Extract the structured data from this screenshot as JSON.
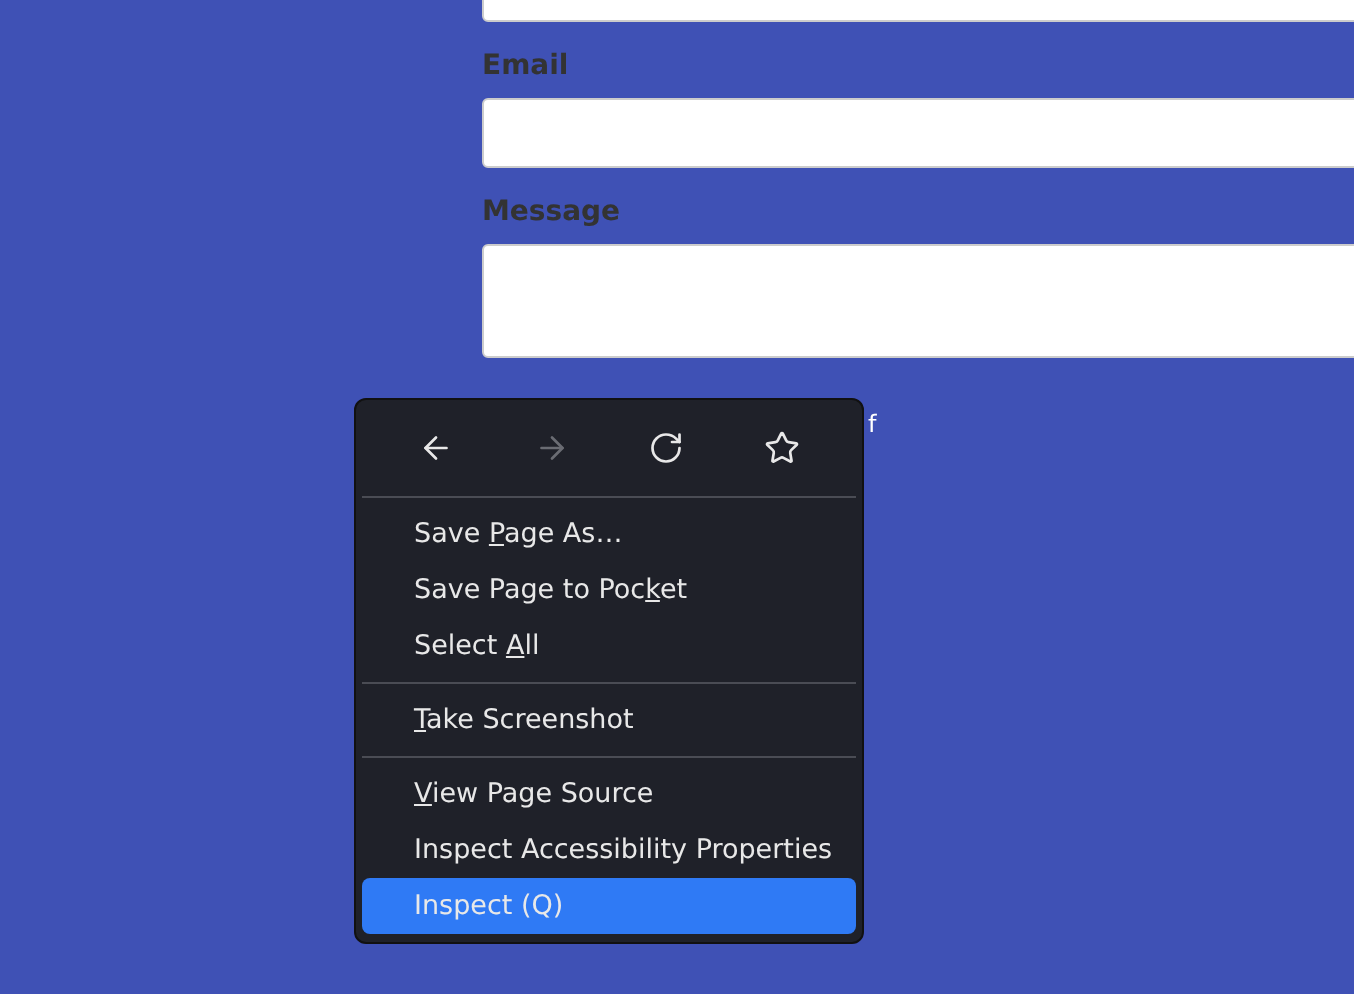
{
  "form": {
    "fields": [
      {
        "kind": "input"
      },
      {
        "kind": "input",
        "label": "Email"
      },
      {
        "kind": "textarea",
        "label": "Message"
      }
    ],
    "text_fragment": "f"
  },
  "context_menu": {
    "nav": [
      {
        "disabled": false
      },
      {
        "disabled": true
      },
      {
        "disabled": false
      },
      {
        "disabled": false
      }
    ],
    "groups": [
      [
        {
          "before": "Save ",
          "key": "P",
          "after": "age As…",
          "selected": false
        },
        {
          "before": "Save Page to Poc",
          "key": "k",
          "after": "et",
          "selected": false
        },
        {
          "before": "Select ",
          "key": "A",
          "after": "ll",
          "selected": false
        }
      ],
      [
        {
          "key": "T",
          "after": "ake Screenshot",
          "selected": false
        }
      ],
      [
        {
          "key": "V",
          "after": "iew Page Source",
          "selected": false
        },
        {
          "before": "Inspect Accessibility Properties",
          "selected": false
        },
        {
          "before": "Inspect (Q)",
          "selected": true
        }
      ]
    ]
  }
}
